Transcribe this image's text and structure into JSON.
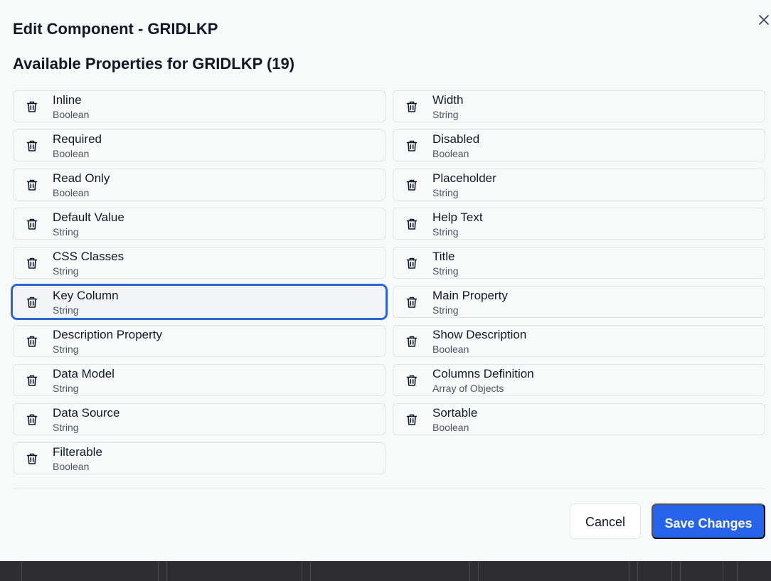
{
  "dialog": {
    "title": "Edit Component - GRIDLKP",
    "subtitle": "Available Properties for GRIDLKP (19)"
  },
  "properties": [
    {
      "name": "Inline",
      "type": "Boolean"
    },
    {
      "name": "Width",
      "type": "String"
    },
    {
      "name": "Required",
      "type": "Boolean"
    },
    {
      "name": "Disabled",
      "type": "Boolean"
    },
    {
      "name": "Read Only",
      "type": "Boolean"
    },
    {
      "name": "Placeholder",
      "type": "String"
    },
    {
      "name": "Default Value",
      "type": "String"
    },
    {
      "name": "Help Text",
      "type": "String"
    },
    {
      "name": "CSS Classes",
      "type": "String"
    },
    {
      "name": "Title",
      "type": "String"
    },
    {
      "name": "Key Column",
      "type": "String",
      "selected": true
    },
    {
      "name": "Main Property",
      "type": "String"
    },
    {
      "name": "Description Property",
      "type": "String"
    },
    {
      "name": "Show Description",
      "type": "Boolean"
    },
    {
      "name": "Data Model",
      "type": "String"
    },
    {
      "name": "Columns Definition",
      "type": "Array of Objects"
    },
    {
      "name": "Data Source",
      "type": "String"
    },
    {
      "name": "Sortable",
      "type": "Boolean"
    },
    {
      "name": "Filterable",
      "type": "Boolean"
    }
  ],
  "icons": {
    "close": "close-icon",
    "delete": "trash-icon"
  },
  "footer": {
    "cancel_label": "Cancel",
    "save_label": "Save Changes"
  },
  "colors": {
    "accent": "#2563eb",
    "selected_ring": "#2563eb"
  }
}
